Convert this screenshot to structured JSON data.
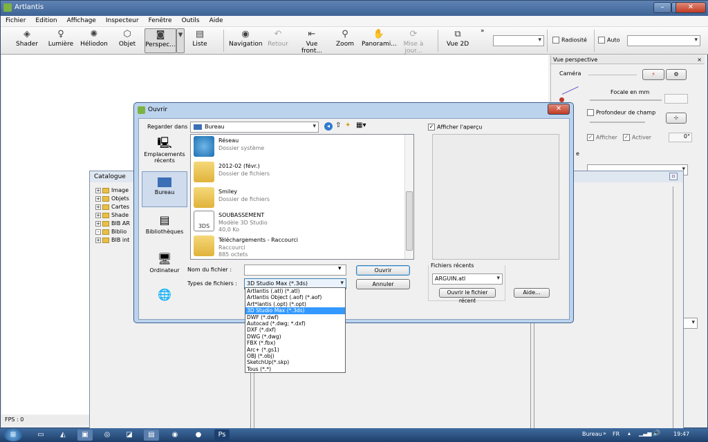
{
  "app": {
    "title": "Artlantis"
  },
  "menu": [
    "Fichier",
    "Edition",
    "Affichage",
    "Inspecteur",
    "Fenêtre",
    "Outils",
    "Aide"
  ],
  "toolbar": {
    "shader": "Shader",
    "lumiere": "Lumière",
    "heliodon": "Héliodon",
    "objet": "Objet",
    "perspec": "Perspec...",
    "liste": "Liste",
    "navigation": "Navigation",
    "retour": "Retour",
    "vue_front": "Vue front...",
    "zoom": "Zoom",
    "panorami": "Panorami...",
    "mise_a_jour": "Mise à jour...",
    "vue2d": "Vue 2D",
    "radiosite": "Radiosité",
    "auto": "Auto",
    "more": "»"
  },
  "panel": {
    "title": "Vue perspective",
    "camera": "Caméra",
    "focale": "Focale en mm",
    "profondeur": "Profondeur de champ",
    "afficher": "Afficher",
    "activer": "Activer",
    "zero": "0",
    "zero_unit": "°",
    "partial_e": "e"
  },
  "catalogue": {
    "title": "Catalogue",
    "items": [
      "Image",
      "Objets",
      "Cartes",
      "Shade",
      "BIB AR",
      "Biblio",
      "BIB int"
    ]
  },
  "status": {
    "fps": "FPS : 0"
  },
  "dialog": {
    "title": "Ouvrir",
    "regarder_label": "Regarder dans :",
    "regarder_value": "Bureau",
    "afficher_apercu": "Afficher l'aperçu",
    "sidebar": [
      "Emplacements récents",
      "Bureau",
      "Bibliothèques",
      "Ordinateur"
    ],
    "files": [
      {
        "name": "Réseau",
        "sub": "Dossier système",
        "sub2": ""
      },
      {
        "name": "2012-02 (févr.)",
        "sub": "Dossier de fichiers",
        "sub2": ""
      },
      {
        "name": "Smiley",
        "sub": "Dossier de fichiers",
        "sub2": ""
      },
      {
        "name": "SOUBASSEMENT",
        "sub": "Modèle 3D Studio",
        "sub2": "40,0 Ko"
      },
      {
        "name": "Téléchargements - Raccourci",
        "sub": "Raccourci",
        "sub2": "885 octets"
      }
    ],
    "threeds": "3DS",
    "nom_label": "Nom du fichier :",
    "nom_value": "",
    "types_label": "Types de fichiers :",
    "types_value": "3D Studio Max (*.3ds)",
    "ouvrir": "Ouvrir",
    "annuler": "Annuler",
    "recents_label": "Fichiers récents",
    "recents_value": "ARGUIN.atl",
    "ouvrir_recent": "Ouvrir le fichier récent",
    "aide": "Aide...",
    "type_options": [
      "Artlantis (.atl) (*.atl)",
      "Artlantis Object (.aof) (*.aof)",
      "Art*lantis (.opt) (*.opt)",
      "3D Studio Max (*.3ds)",
      "DWF (*.dwf)",
      "Autocad (*.dwg; *.dxf)",
      "DXF (*.dxf)",
      "DWG (*.dwg)",
      "FBX (*.fbx)",
      "Arc+ (*.gs1)",
      "OBJ (*.obj)",
      "SketchUp(*.skp)",
      "Tous (*.*)"
    ],
    "selected_option_index": 3
  },
  "taskbar": {
    "bureau": "Bureau",
    "more": "»",
    "lang": "FR",
    "time": "19:47"
  }
}
